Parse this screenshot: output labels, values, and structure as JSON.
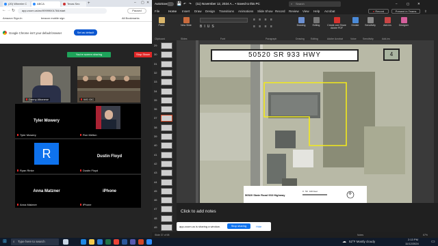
{
  "browser": {
    "tabs": [
      {
        "label": "(20) Wheeler C"
      },
      {
        "label": "ABCA"
      },
      {
        "label": "Texas Sec"
      }
    ],
    "url": "app.zoom.us/wc/99999001784/start",
    "bookmarks": [
      {
        "label": "Amazon Sign-In"
      },
      {
        "label": "beacon mobile sign"
      },
      {
        "label": "All Bookmarks"
      }
    ],
    "profile_label": "Paused",
    "default_prompt": "Google Chrome isn't your default browser",
    "default_button": "Set as default"
  },
  "zoom": {
    "sharing_banner": "You're screen sharing",
    "stop_share": "Stop Share",
    "tiles": [
      {
        "name": "Danny Albanese",
        "big": ""
      },
      {
        "name": "WG GIC",
        "big": ""
      },
      {
        "name": "Tyler Mowery",
        "big": "Tyler Mowery"
      },
      {
        "name": "Ron Melton",
        "big": ""
      },
      {
        "name": "Ryan Rinke",
        "big": "R"
      },
      {
        "name": "Dustin Floyd",
        "big": "Dustin Floyd"
      },
      {
        "name": "Anna Matzner",
        "big": "Anna Matzner"
      },
      {
        "name": "iPhone",
        "big": "iPhone"
      }
    ],
    "share_notice": "app.zoom.us is sharing a window.",
    "share_notice_stop": "Stop sharing",
    "share_notice_hide": "Hide"
  },
  "ppt": {
    "title": "(11) November 12, 2024 A... • Saved to this PC",
    "search_placeholder": "Search",
    "menu": [
      "File",
      "Home",
      "Insert",
      "Draw",
      "Design",
      "Transitions",
      "Animations",
      "Slide Show",
      "Record",
      "Review",
      "View",
      "Help",
      "Acrobat"
    ],
    "record_button": "Record",
    "present_button": "Present in Teams",
    "ribbon_groups": [
      "Clipboard",
      "Slides",
      "Font",
      "Paragraph",
      "Drawing",
      "Editing",
      "Adobe Acrobat",
      "Voice",
      "Sensitivity",
      "Add-ins"
    ],
    "ribbon_buttons": [
      {
        "label": "Paste"
      },
      {
        "label": "New Slide"
      },
      {
        "label": "Drawing"
      },
      {
        "label": "Editing"
      },
      {
        "label": "Create and Share Adobe PDF"
      },
      {
        "label": "Dictate"
      },
      {
        "label": "Sensitivity"
      },
      {
        "label": "Add-ins"
      },
      {
        "label": "Designer"
      }
    ],
    "thumb_numbers": [
      "29",
      "30",
      "31",
      "32",
      "33",
      "34",
      "35",
      "36",
      "37",
      "38",
      "39",
      "40",
      "41",
      "42",
      "43",
      "44",
      "45",
      "46",
      "47",
      "48",
      "49"
    ],
    "slide": {
      "address": "50520 SR 933 HWY",
      "number": "4",
      "caption": "50520 State Road 933 Highway"
    },
    "notes_placeholder": "Click to add notes",
    "status_left": "Slide 37 of 98",
    "status_right": "Notes",
    "zoom_level": "67%"
  },
  "taskbar": {
    "search_placeholder": "Type here to search",
    "weather": "52°F  Mostly cloudy",
    "time": "2:13 PM",
    "date": "11/12/2024"
  },
  "colors": {
    "zoom_green": "#1ea35a",
    "zoom_red": "#e02828",
    "zoom_blue": "#0e72ed",
    "highlight_yellow": "#f3ea1c"
  }
}
